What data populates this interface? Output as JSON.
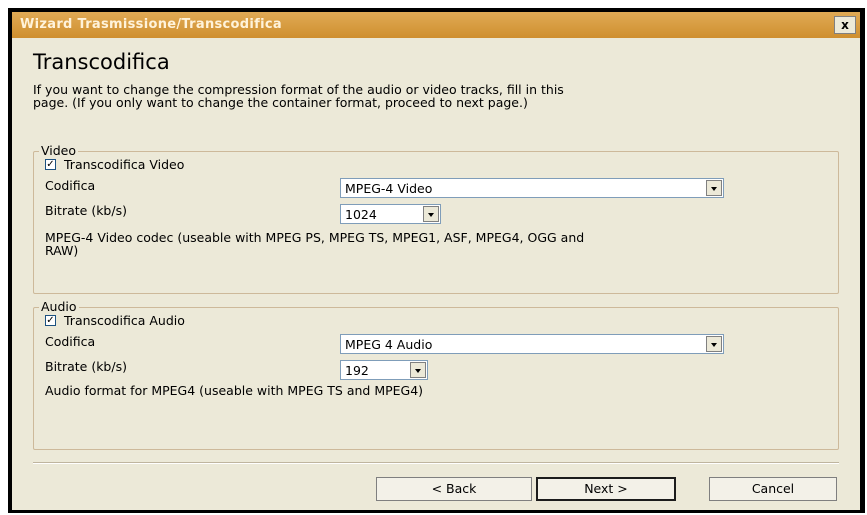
{
  "window": {
    "title": "Wizard Trasmissione/Transcodifica",
    "close_label": "x"
  },
  "page": {
    "heading": "Transcodifica",
    "intro": "If you want to change the compression format of the audio or video tracks, fill in this page. (If you only want to change the container format, proceed to next page.)"
  },
  "video": {
    "group_label": "Video",
    "checkbox_label": "Transcodifica Video",
    "checked": true,
    "codec_label": "Codifica",
    "codec_value": "MPEG-4 Video",
    "bitrate_label": "Bitrate (kb/s)",
    "bitrate_value": "1024",
    "description": "MPEG-4 Video codec (useable with MPEG PS, MPEG TS, MPEG1, ASF, MPEG4, OGG and RAW)"
  },
  "audio": {
    "group_label": "Audio",
    "checkbox_label": "Transcodifica Audio",
    "checked": true,
    "codec_label": "Codifica",
    "codec_value": "MPEG 4 Audio",
    "bitrate_label": "Bitrate (kb/s)",
    "bitrate_value": "192",
    "description": "Audio format for MPEG4 (useable with MPEG TS and MPEG4)"
  },
  "buttons": {
    "back": "< Back",
    "next": "Next >",
    "cancel": "Cancel"
  },
  "colors": {
    "titlebar": "#d49a3f",
    "dialog_bg": "#ece9d8",
    "groupbox_border": "#cdb99a"
  }
}
